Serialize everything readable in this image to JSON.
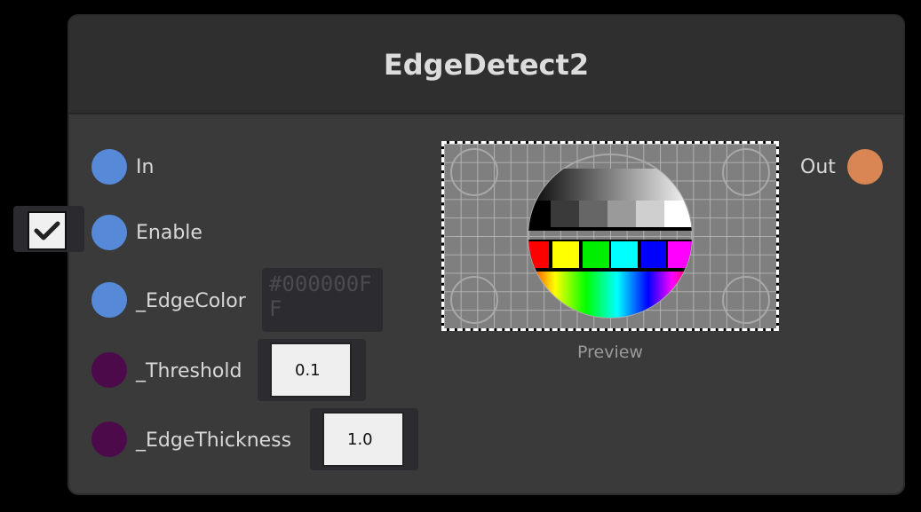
{
  "node": {
    "title": "EdgeDetect2",
    "inputs": [
      {
        "label": "In"
      },
      {
        "label": "Enable",
        "checked": true
      },
      {
        "label": "_EdgeColor",
        "value": "#000000FF"
      },
      {
        "label": "_Threshold",
        "value": "0.1"
      },
      {
        "label": "_EdgeThickness",
        "value": "1.0"
      }
    ],
    "output": {
      "label": "Out"
    },
    "preview": {
      "caption": "Preview"
    }
  },
  "colors": {
    "port_blue": "#5689d8",
    "port_purple": "#4d0a4a",
    "port_orange": "#d98654",
    "node_bg": "#3a3a3a",
    "header_bg": "#2f2f2f"
  },
  "icons": {
    "checkbox": "checkmark-icon"
  }
}
